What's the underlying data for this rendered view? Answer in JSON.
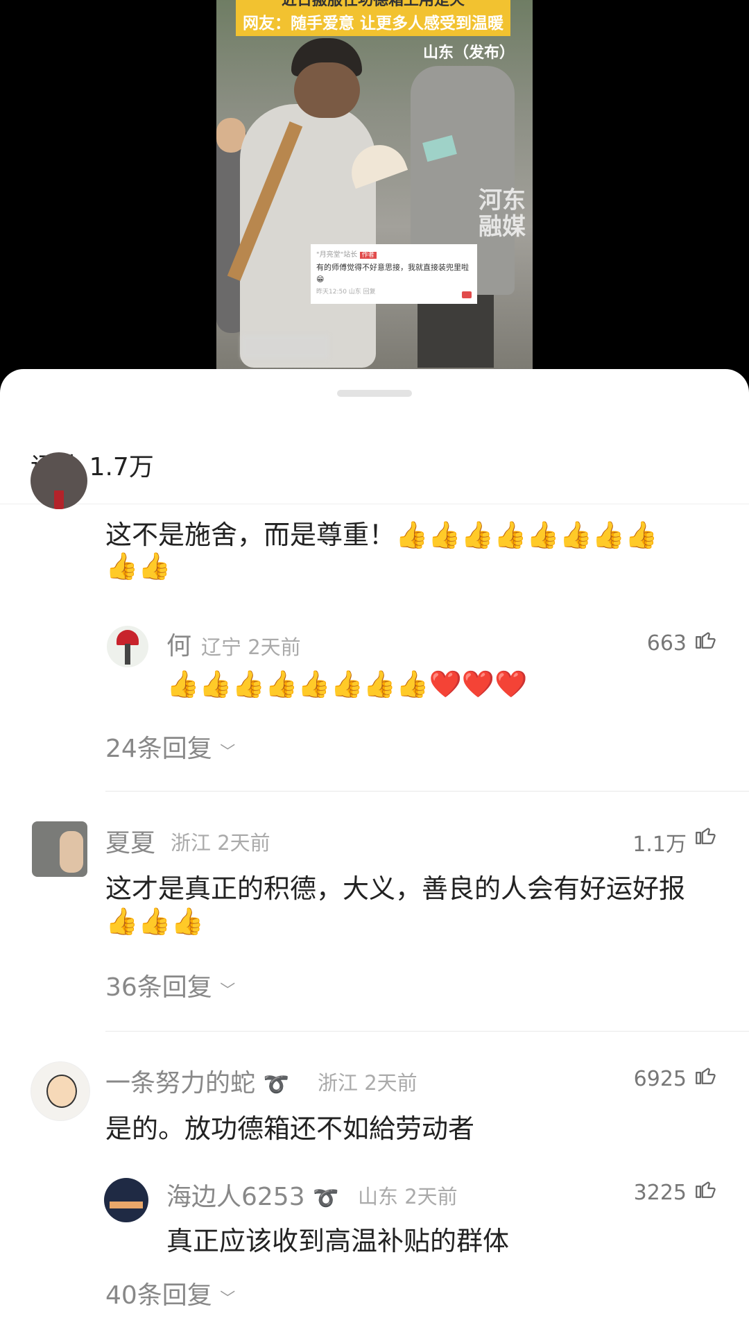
{
  "video": {
    "title_line1": "近日搬服任功德箱上用是火",
    "title_line2": "网友：随手爱意 让更多人感受到温暖",
    "location_tag": "山东（发布）",
    "watermark": "河东\n融媒",
    "snippet": {
      "user": "\"月亮堂\"站长",
      "tag": "作者",
      "text": "有的师傅觉得不好意思接，我就直接装兜里啦😁",
      "meta": "昨天12:50  山东  回复"
    }
  },
  "sheet": {
    "title": "评论",
    "count": "1.7万"
  },
  "comments": [
    {
      "text": "这不是施舍，而是尊重！👍👍👍👍👍👍👍👍👍👍",
      "line1": "这不是施舍，而是尊重！👍👍👍👍👍👍👍👍",
      "line2": "👍👍",
      "reply": {
        "user": "何",
        "location": "辽宁",
        "time": "2天前",
        "likes": "663",
        "text": "👍👍👍👍👍👍👍👍❤️❤️❤️"
      },
      "replies_label": "24条回复"
    },
    {
      "user": "夏夏",
      "location": "浙江",
      "time": "2天前",
      "likes": "1.1万",
      "line1": "这才是真正的积德，大义，善良的人会有好运好报",
      "line2": "👍👍👍",
      "replies_label": "36条回复"
    },
    {
      "user": "一条努力的蛇",
      "location": "浙江",
      "time": "2天前",
      "likes": "6925",
      "text": "是的。放功德箱还不如給劳动者",
      "reply": {
        "user": "海边人6253",
        "location": "山东",
        "time": "2天前",
        "likes": "3225",
        "text": "真正应该收到高温补贴的群体"
      },
      "replies_label": "40条回复"
    }
  ],
  "icons": {
    "like": "thumbs-up-outline-icon",
    "expand": "chevron-down-icon",
    "badge": "ribbon-badge-icon"
  }
}
